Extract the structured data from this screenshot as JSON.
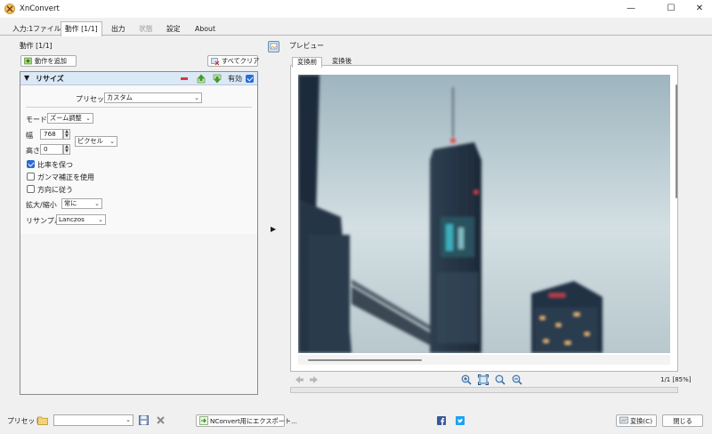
{
  "window": {
    "title": "XnConvert",
    "minimize": "—",
    "maximize": "☐",
    "close": "✕"
  },
  "tabs": [
    {
      "label": "入力:1ファイル"
    },
    {
      "label": "動作 [1/1]"
    },
    {
      "label": "出力"
    },
    {
      "label": "状態"
    },
    {
      "label": "設定"
    },
    {
      "label": "About"
    }
  ],
  "actions_panel": {
    "label": "動作 [1/1]",
    "add_button": "動作を追加",
    "clear_button": "すべてクリア"
  },
  "resize": {
    "title": "リサイズ",
    "enabled_label": "有効",
    "enabled": true,
    "preset_label": "プリセット",
    "preset_value": "カスタム",
    "mode_label": "モード",
    "mode_value": "ズーム調整",
    "width_label": "幅",
    "width_value": "768",
    "height_label": "高さ",
    "height_value": "0",
    "unit_value": "ピクセル",
    "keep_ratio_label": "比率を保つ",
    "keep_ratio": true,
    "gamma_label": "ガンマ補正を使用",
    "gamma": false,
    "orientation_label": "方向に従う",
    "orientation": false,
    "enlarge_label": "拡大/縮小",
    "enlarge_value": "常に",
    "resample_label": "リサンプル",
    "resample_value": "Lanczos"
  },
  "preview": {
    "label": "プレビュー",
    "tab_before": "変換前",
    "tab_after": "変換後",
    "page_info": "1/1 [85%]",
    "progress": 0
  },
  "bottom": {
    "preset_label": "プリセット:",
    "preset_value": "",
    "export_button": "NConvert用にエクスポート...",
    "convert_button": "変換(C)",
    "close_button": "閉じる"
  },
  "colors": {
    "accent": "#2e6bd2",
    "panel_header": "#dbe8f6",
    "facebook": "#3b5998",
    "twitter": "#1da1f2"
  }
}
